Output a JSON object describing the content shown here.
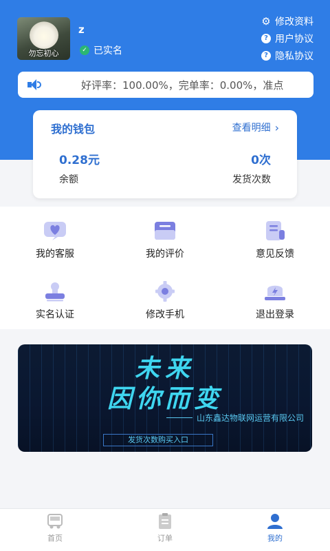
{
  "profile": {
    "avatar_caption": "勿忘初心",
    "username": "z",
    "verified_label": "已实名"
  },
  "top_links": [
    {
      "label": "修改资料",
      "icon": "gear-icon"
    },
    {
      "label": "用户协议",
      "icon": "question-icon"
    },
    {
      "label": "隐私协议",
      "icon": "question-icon"
    }
  ],
  "notice": {
    "text": "好评率：100.00%，完单率：0.00%，准点"
  },
  "wallet": {
    "title": "我的钱包",
    "detail_link": "查看明细",
    "balance_value": "0.28元",
    "balance_label": "余额",
    "shipment_count_value": "0次",
    "shipment_count_label": "发货次数"
  },
  "menu": [
    {
      "label": "我的客服",
      "icon": "heart-chat-icon"
    },
    {
      "label": "我的评价",
      "icon": "mail-icon"
    },
    {
      "label": "意见反馈",
      "icon": "feedback-icon"
    },
    {
      "label": "实名认证",
      "icon": "stamp-icon"
    },
    {
      "label": "修改手机",
      "icon": "gear-icon"
    },
    {
      "label": "退出登录",
      "icon": "logout-icon"
    }
  ],
  "banner": {
    "line1": "未来",
    "line2": "因你而变",
    "company": "山东鑫达物联网运营有限公司",
    "cta": "发货次数购买入口"
  },
  "tabbar": [
    {
      "label": "首页",
      "icon": "truck-icon",
      "active": false
    },
    {
      "label": "订单",
      "icon": "clipboard-icon",
      "active": false
    },
    {
      "label": "我的",
      "icon": "user-icon",
      "active": true
    }
  ],
  "colors": {
    "primary": "#2f7de6",
    "accent_text": "#2f6fd0",
    "icon_purple": "#7b7fe0"
  }
}
